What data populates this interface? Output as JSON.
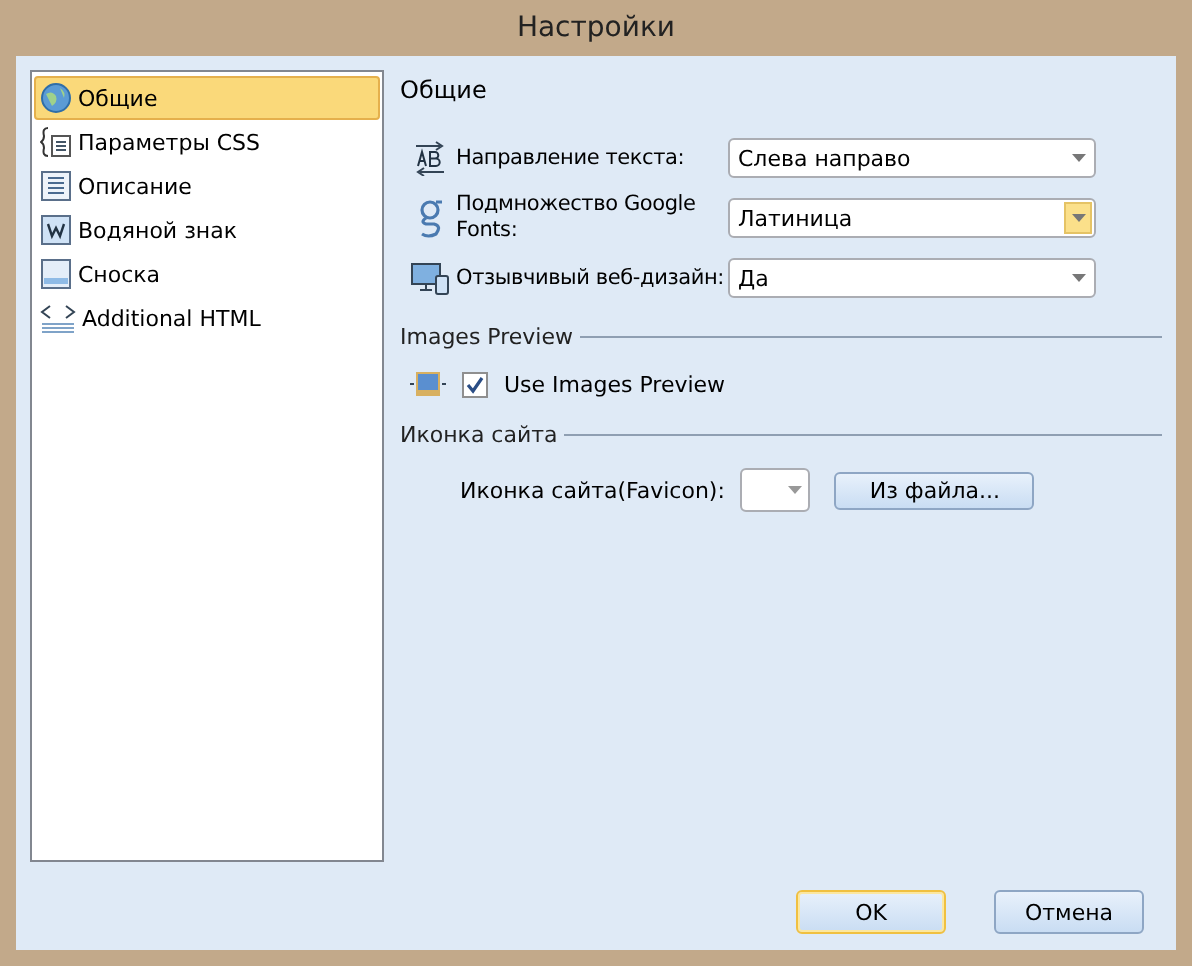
{
  "window": {
    "title": "Настройки"
  },
  "sidebar": {
    "items": [
      {
        "label": "Общие",
        "selected": true
      },
      {
        "label": "Параметры CSS",
        "selected": false
      },
      {
        "label": "Описание",
        "selected": false
      },
      {
        "label": "Водяной знак",
        "selected": false
      },
      {
        "label": "Сноска",
        "selected": false
      },
      {
        "label": "Additional HTML",
        "selected": false
      }
    ]
  },
  "panel": {
    "title": "Общие",
    "settings": [
      {
        "label": "Направление текста:",
        "value": "Слева направо",
        "hovered": false
      },
      {
        "label": "Подмножество Google Fonts:",
        "value": "Латиница",
        "hovered": true
      },
      {
        "label": "Отзывчивый веб-дизайн:",
        "value": "Да",
        "hovered": false
      }
    ],
    "images_preview": {
      "heading": "Images Preview",
      "checkbox": {
        "label": "Use Images Preview",
        "checked": true
      }
    },
    "favicon": {
      "heading": "Иконка сайта",
      "label": "Иконка сайта(Favicon):",
      "button": "Из файла..."
    }
  },
  "buttons": [
    {
      "label": "OK",
      "default": true
    },
    {
      "label": "Отмена",
      "default": false
    }
  ]
}
